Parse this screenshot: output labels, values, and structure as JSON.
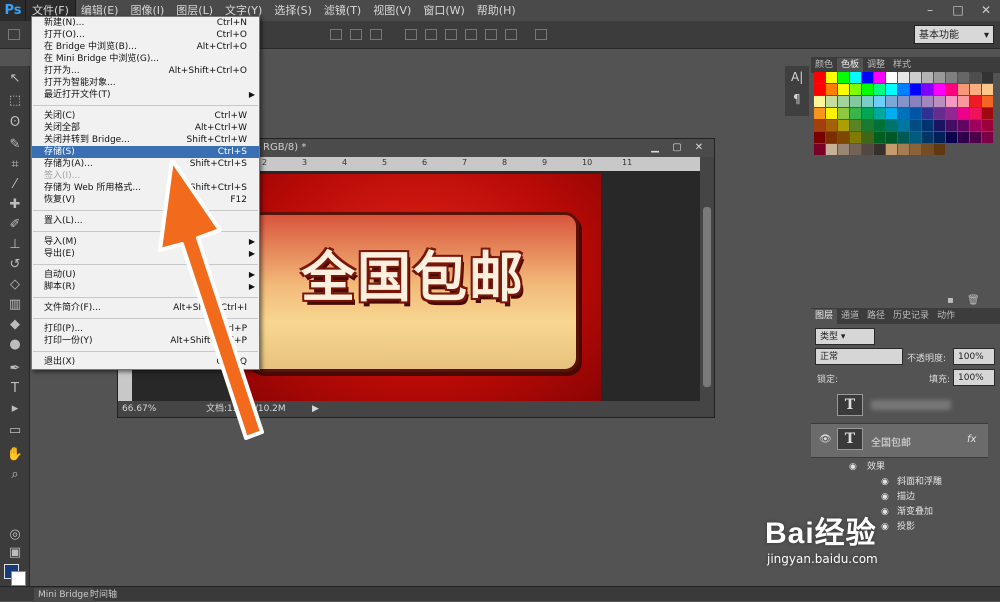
{
  "app": {
    "logo": "Ps"
  },
  "menubar": {
    "items": [
      "文件(F)",
      "编辑(E)",
      "图像(I)",
      "图层(L)",
      "文字(Y)",
      "选择(S)",
      "滤镜(T)",
      "视图(V)",
      "窗口(W)",
      "帮助(H)"
    ],
    "window_controls": [
      "–",
      "□",
      "✕"
    ]
  },
  "options_bar": {
    "workspace": "基本功能"
  },
  "file_menu": {
    "items": [
      {
        "label": "新建(N)...",
        "shortcut": "Ctrl+N"
      },
      {
        "label": "打开(O)...",
        "shortcut": "Ctrl+O"
      },
      {
        "label": "在 Bridge 中浏览(B)...",
        "shortcut": "Alt+Ctrl+O"
      },
      {
        "label": "在 Mini Bridge 中浏览(G)...",
        "shortcut": ""
      },
      {
        "label": "打开为...",
        "shortcut": "Alt+Shift+Ctrl+O"
      },
      {
        "label": "打开为智能对象...",
        "shortcut": ""
      },
      {
        "label": "最近打开文件(T)",
        "shortcut": "",
        "submenu": true
      },
      {
        "label": "关闭(C)",
        "shortcut": "Ctrl+W",
        "sep": true
      },
      {
        "label": "关闭全部",
        "shortcut": "Alt+Ctrl+W"
      },
      {
        "label": "关闭并转到 Bridge...",
        "shortcut": "Shift+Ctrl+W"
      },
      {
        "label": "存储(S)",
        "shortcut": "Ctrl+S",
        "selected": true
      },
      {
        "label": "存储为(A)...",
        "shortcut": "Shift+Ctrl+S"
      },
      {
        "label": "签入(I)...",
        "shortcut": "",
        "disabled": true
      },
      {
        "label": "存储为 Web 所用格式...",
        "shortcut": "Alt+Shift+Ctrl+S"
      },
      {
        "label": "恢复(V)",
        "shortcut": "F12"
      },
      {
        "label": "置入(L)...",
        "shortcut": "",
        "sep": true
      },
      {
        "label": "导入(M)",
        "shortcut": "",
        "submenu": true,
        "sep": true
      },
      {
        "label": "导出(E)",
        "shortcut": "",
        "submenu": true
      },
      {
        "label": "自动(U)",
        "shortcut": "",
        "submenu": true,
        "sep": true
      },
      {
        "label": "脚本(R)",
        "shortcut": "",
        "submenu": true
      },
      {
        "label": "文件简介(F)...",
        "shortcut": "Alt+Shift+Ctrl+I",
        "sep": true
      },
      {
        "label": "打印(P)...",
        "shortcut": "Ctrl+P",
        "sep": true
      },
      {
        "label": "打印一份(Y)",
        "shortcut": "Alt+Shift+Ctrl+P"
      },
      {
        "label": "退出(X)",
        "shortcut": "Ctrl+Q",
        "sep": true
      }
    ]
  },
  "document": {
    "title": "RGB/8) *",
    "zoom": "66.67%",
    "doc_info": "文档:1.06M/10.2M",
    "banner_text": "全国包邮",
    "ruler_ticks": [
      "2",
      "3",
      "4",
      "5",
      "6",
      "7",
      "8",
      "9",
      "10",
      "11"
    ]
  },
  "swatch_panel": {
    "tabs": [
      "颜色",
      "色板",
      "调整",
      "样式"
    ],
    "active_tab": "色板",
    "colors": [
      "#ff0000",
      "#ffff00",
      "#00ff00",
      "#00ffff",
      "#0000ff",
      "#ff00ff",
      "#ffffff",
      "#e6e6e6",
      "#cccccc",
      "#b3b3b3",
      "#999999",
      "#808080",
      "#666666",
      "#4d4d4d",
      "#333333",
      "#ff0000",
      "#ff7f00",
      "#ffff00",
      "#7fff00",
      "#00ff00",
      "#00ff7f",
      "#00ffff",
      "#007fff",
      "#0000ff",
      "#7f00ff",
      "#ff00ff",
      "#ff007f",
      "#f7977a",
      "#f9ad81",
      "#fdc68a",
      "#fff79a",
      "#c4df9b",
      "#a3d39c",
      "#82ca9d",
      "#7bcdc8",
      "#6ecff6",
      "#7ea7d8",
      "#8493ca",
      "#8882be",
      "#a187be",
      "#bc8dbf",
      "#f49ac2",
      "#f6989d",
      "#ed1c24",
      "#f26522",
      "#f7941d",
      "#fff200",
      "#8dc63f",
      "#39b54a",
      "#00a651",
      "#00a99d",
      "#00aeef",
      "#0072bc",
      "#0054a6",
      "#2e3192",
      "#662d91",
      "#92278f",
      "#ec008c",
      "#ed145b",
      "#9e0b0f",
      "#a0410d",
      "#a36209",
      "#aba000",
      "#598527",
      "#1a7b30",
      "#007236",
      "#00746b",
      "#0076a3",
      "#004b80",
      "#003471",
      "#1b1464",
      "#440e62",
      "#630460",
      "#9e005d",
      "#9e0039",
      "#790000",
      "#7b2e00",
      "#7d4900",
      "#827b00",
      "#406618",
      "#005e20",
      "#005826",
      "#005952",
      "#005b7f",
      "#003663",
      "#002157",
      "#0d004c",
      "#32004b",
      "#4b0049",
      "#7b0046",
      "#7a0026",
      "#c7b299",
      "#998675",
      "#736357",
      "#534741",
      "#37302d",
      "#c69c6d",
      "#a67c52",
      "#8c6239",
      "#754c24",
      "#603913"
    ]
  },
  "layers_panel": {
    "tabs": [
      "图层",
      "通道",
      "路径",
      "历史记录",
      "动作"
    ],
    "active_tab": "图层",
    "filter": "类型",
    "blend_mode": "正常",
    "opacity_label": "不透明度:",
    "opacity": "100%",
    "lock_label": "锁定:",
    "fill_label": "填充:",
    "fill": "100%",
    "layers": [
      {
        "name": "全国包邮",
        "fx": "fx",
        "selected": true
      }
    ],
    "effects_label": "效果",
    "effects": [
      "斜面和浮雕",
      "描边",
      "渐变叠加",
      "投影"
    ]
  },
  "footer": {
    "tabs": [
      "Mini Bridge",
      "时间轴"
    ]
  },
  "watermark": {
    "big": "Bai经验",
    "small": "jingyan.baidu.com"
  }
}
